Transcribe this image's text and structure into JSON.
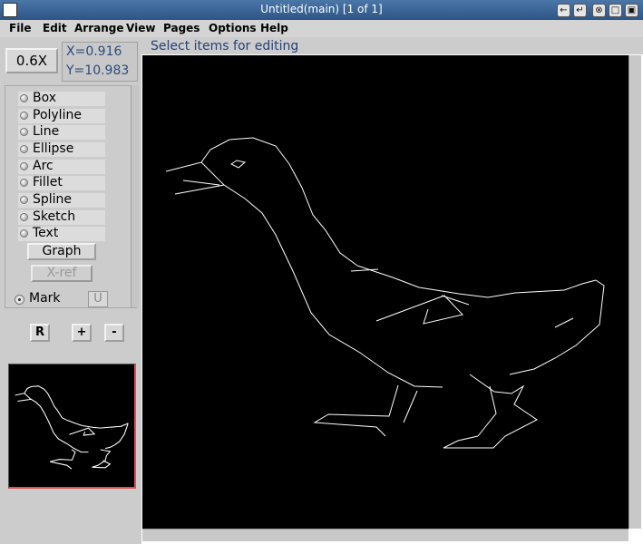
{
  "window": {
    "title": "Untitled(main) [1 of 1]",
    "buttons": [
      "←",
      "↵",
      "⊗",
      "□",
      "▣"
    ]
  },
  "menu": [
    {
      "label": "File"
    },
    {
      "label": "Edit"
    },
    {
      "label": "Arrange"
    },
    {
      "label": "View"
    },
    {
      "label": "Pages"
    },
    {
      "label": "Options"
    },
    {
      "label": "Help"
    }
  ],
  "zoom": {
    "label": "0.6X"
  },
  "coords": {
    "x": "X=0.916",
    "y": "Y=10.983"
  },
  "tools": [
    {
      "label": "Box"
    },
    {
      "label": "Polyline"
    },
    {
      "label": "Line"
    },
    {
      "label": "Ellipse"
    },
    {
      "label": "Arc"
    },
    {
      "label": "Fillet"
    },
    {
      "label": "Spline"
    },
    {
      "label": "Sketch"
    },
    {
      "label": "Text"
    }
  ],
  "graph_button": {
    "label": "Graph"
  },
  "xref_button": {
    "label": "X-ref"
  },
  "mark": {
    "label": "Mark",
    "u_label": "U"
  },
  "nav_buttons": {
    "reset": "R",
    "plus": "+",
    "minus": "-"
  },
  "status": {
    "text": "Select items for editing"
  },
  "colors": {
    "accent": "#2c4a80",
    "canvas": "#000000",
    "stroke": "#ffffff"
  }
}
